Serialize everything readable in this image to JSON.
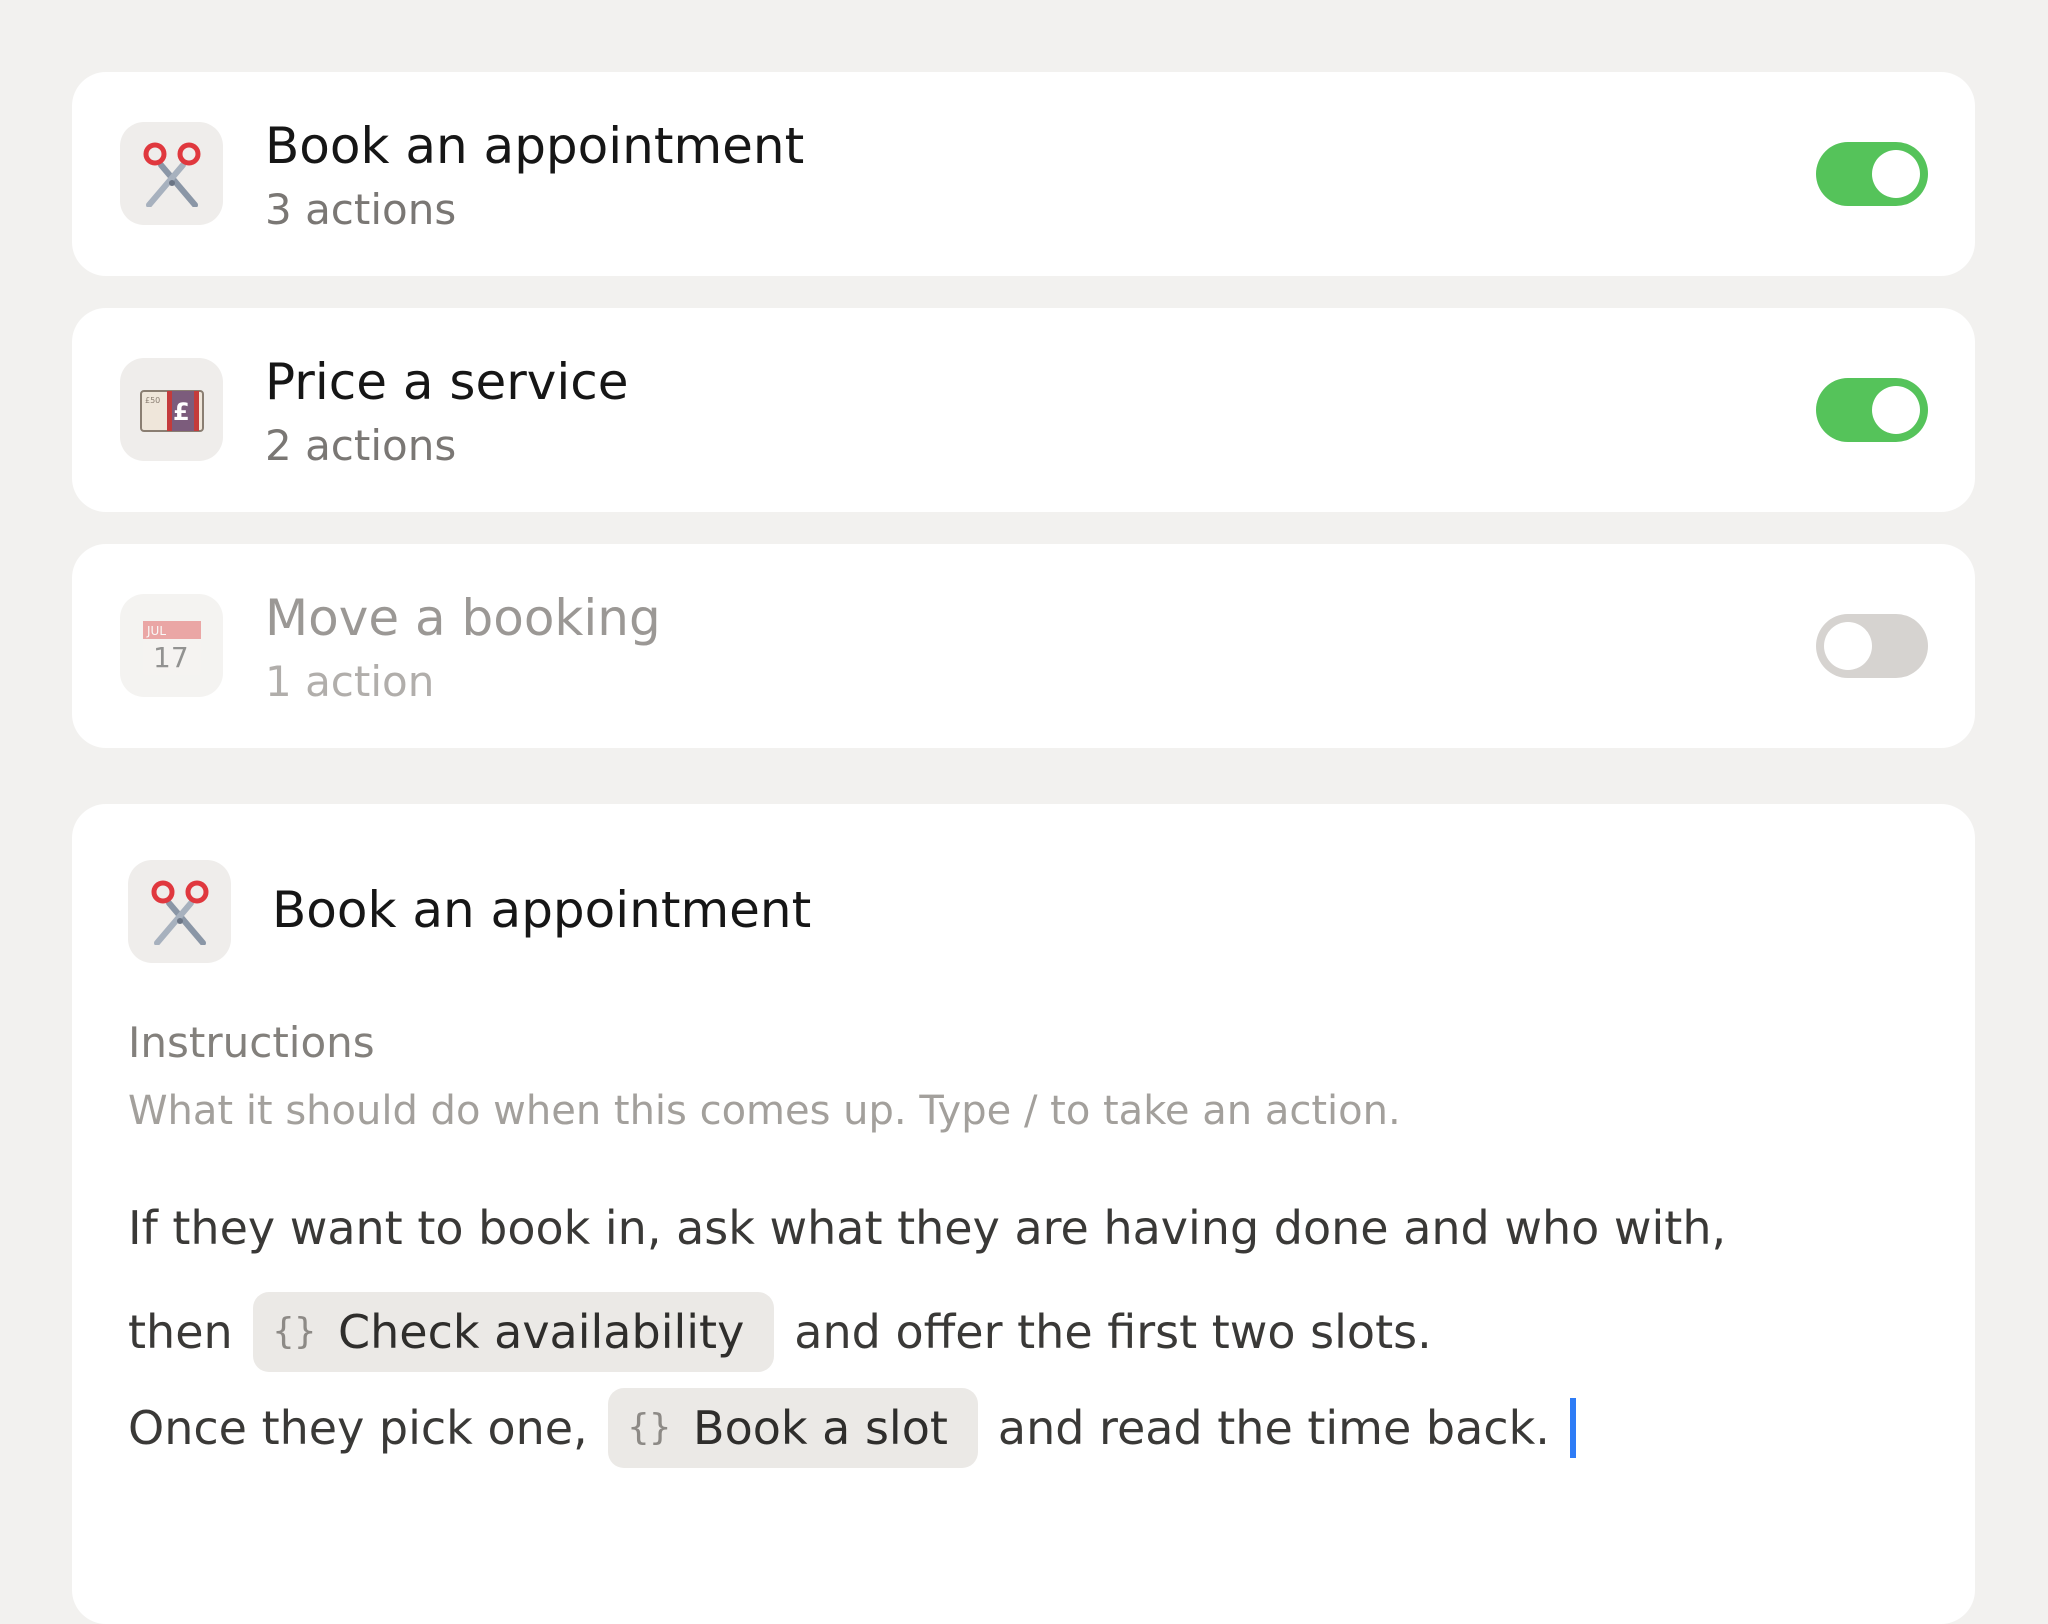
{
  "tasks": [
    {
      "title": "Book an appointment",
      "subtitle": "3 actions",
      "icon": "scissors-icon",
      "enabled": true
    },
    {
      "title": "Price a service",
      "subtitle": "2 actions",
      "icon": "pound-banknote-icon",
      "enabled": true
    },
    {
      "title": "Move a booking",
      "subtitle": "1 action",
      "icon": "calendar-icon",
      "enabled": false
    }
  ],
  "detail": {
    "icon": "scissors-icon",
    "title": "Book an appointment",
    "instructions_label": "Instructions",
    "instructions_help": "What it should do when this comes up. Type / to take an action.",
    "line1": "If they want to book in, ask what they are having done and who with,",
    "line2_before": "then",
    "chip1_braces": "{}",
    "chip1_label": "Check availability",
    "line2_after": "and offer the first two slots.",
    "line3_before": "Once they pick one,",
    "chip2_braces": "{}",
    "chip2_label": "Book a slot",
    "line3_after": "and read the time back."
  },
  "calendar_icon": {
    "month": "JUL",
    "day": "17"
  },
  "colors": {
    "background": "#f2f1ef",
    "toggle_on": "#55c35a",
    "toggle_off": "#d6d3d0",
    "caret": "#2e7cf6"
  }
}
